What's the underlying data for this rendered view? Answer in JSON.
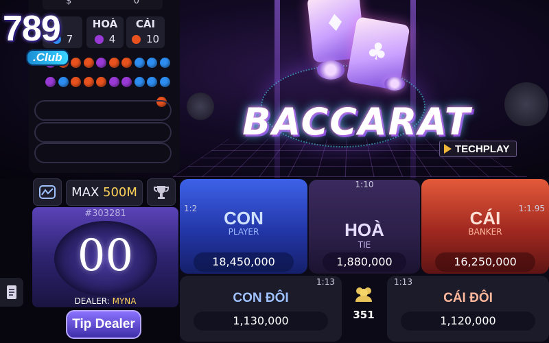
{
  "brand": {
    "number": "789",
    "club": ".Club"
  },
  "roadmap": {
    "top_left": "$",
    "top_right": "0",
    "counters": [
      {
        "label": "",
        "value": "7",
        "color": "#2e8df0"
      },
      {
        "label": "HOÀ",
        "value": "4",
        "color": "#9a3ad6"
      },
      {
        "label": "CÁI",
        "value": "10",
        "color": "#e8521e"
      }
    ],
    "bead_rows": [
      [
        "#9a3ad6",
        "#e8521e",
        "#e8521e",
        "#e8521e",
        "#9a3ad6",
        "#e8521e",
        "#e8521e",
        "#2e8df0",
        "#2e8df0",
        "#2e8df0"
      ],
      [
        "#9a3ad6",
        "#2e8df0",
        "#e8521e",
        "#e8521e",
        "#e8521e",
        "#9a3ad6",
        "#9a3ad6",
        "#2e8df0",
        "#2e8df0",
        "#2e8df0"
      ],
      [
        "#e8521e"
      ]
    ]
  },
  "controls": {
    "max_label": "MAX",
    "max_value": "500M",
    "round_id": "#303281",
    "timer": "00",
    "dealer_label": "DEALER:",
    "dealer_name": "MYNA",
    "tip_label": "Tip Dealer"
  },
  "stage": {
    "logo": "BACCARAT",
    "provider": "TECHPLAY"
  },
  "bets": {
    "con": {
      "ratio": "1:2",
      "title": "CON",
      "sub": "PLAYER",
      "amount": "18,450,000"
    },
    "hoa": {
      "ratio": "1:10",
      "title": "HOÀ",
      "sub": "TIE",
      "amount": "1,880,000"
    },
    "cai": {
      "ratio": "1:1.95",
      "title": "CÁI",
      "sub": "BANKER",
      "amount": "16,250,000"
    },
    "con_doi": {
      "ratio": "1:13",
      "title": "CON ĐÔI",
      "amount": "1,130,000"
    },
    "cai_doi": {
      "ratio": "1:13",
      "title": "CÁI ĐÔI",
      "amount": "1,120,000"
    },
    "players_count": "351"
  },
  "colors": {
    "player": "#3d62e8",
    "banker": "#e35a3a",
    "tie": "#9a3ad6",
    "gold": "#ffd35a"
  }
}
